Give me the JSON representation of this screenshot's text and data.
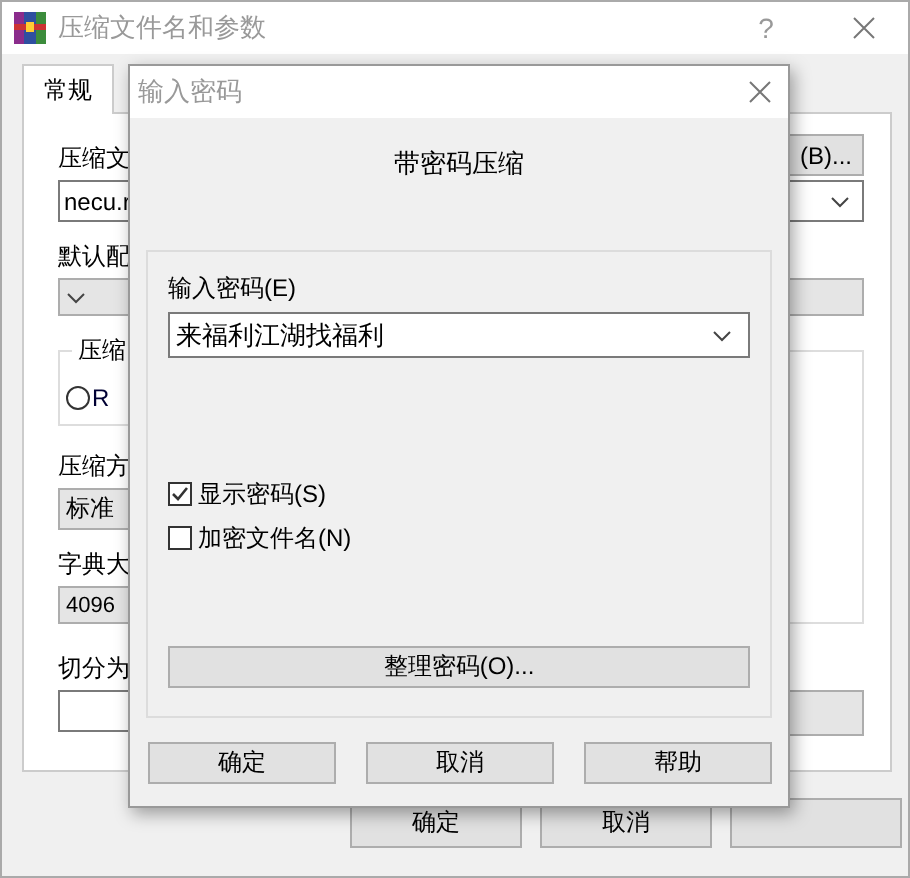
{
  "main_window": {
    "title": "压缩文件名和参数",
    "help_glyph": "?",
    "tabs": [
      {
        "label": "常规",
        "selected": true
      }
    ],
    "archive_label": "压缩文",
    "browse_button": "(B)...",
    "archive_name": "necu.r",
    "profile_label": "默认配",
    "format_group": {
      "title": "压缩",
      "options": [
        {
          "label": "R",
          "selected": false
        }
      ]
    },
    "method_label": "压缩方",
    "method": "标准",
    "dictionary_label": "字典大",
    "dictionary": "4096",
    "split_label": "切分为",
    "buttons": [
      "确定",
      "取消"
    ]
  },
  "password_dialog": {
    "title": "输入密码",
    "heading": "带密码压缩",
    "password_label": "输入密码(E)",
    "password_value": "来福利江湖找福利",
    "checkboxes": [
      {
        "label": "显示密码(S)",
        "checked": true
      },
      {
        "label": "加密文件名(N)",
        "checked": false
      }
    ],
    "organize_button": "整理密码(O)...",
    "buttons": [
      "确定",
      "取消",
      "帮助"
    ]
  }
}
